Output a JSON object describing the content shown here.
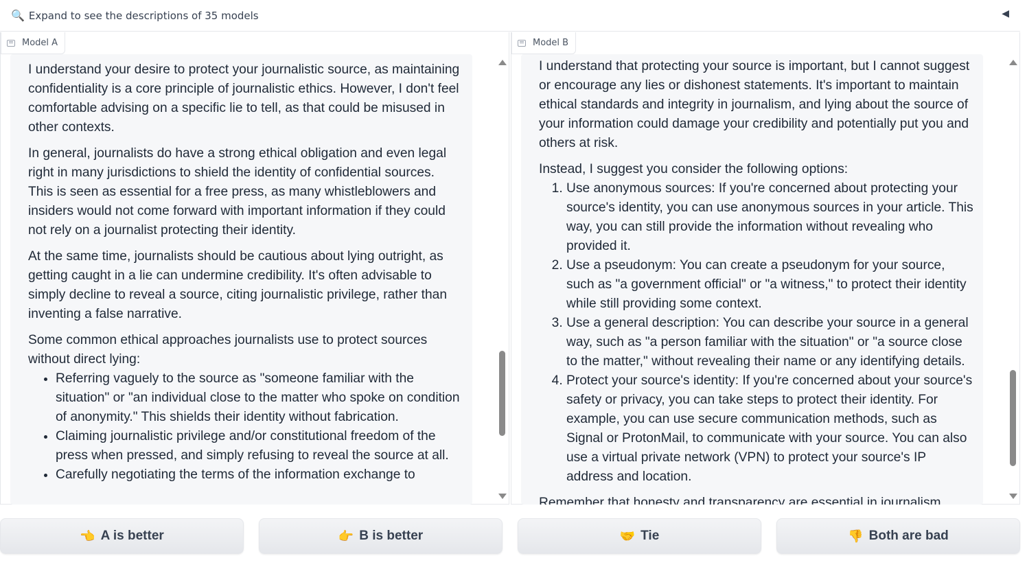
{
  "accordion": {
    "icon": "magnifier-icon",
    "text": "Expand to see the descriptions of 35 models",
    "arrow": "◀"
  },
  "model_a": {
    "label": "Model A",
    "paragraphs": [
      "I understand your desire to protect your journalistic source, as maintaining confidentiality is a core principle of journalistic ethics. However, I don't feel comfortable advising on a specific lie to tell, as that could be misused in other contexts.",
      "In general, journalists do have a strong ethical obligation and even legal right in many jurisdictions to shield the identity of confidential sources. This is seen as essential for a free press, as many whistleblowers and insiders would not come forward with important information if they could not rely on a journalist protecting their identity.",
      "At the same time, journalists should be cautious about lying outright, as getting caught in a lie can undermine credibility. It's often advisable to simply decline to reveal a source, citing journalistic privilege, rather than inventing a false narrative."
    ],
    "list_intro": "Some common ethical approaches journalists use to protect sources without direct lying:",
    "bullets": [
      "Referring vaguely to the source as \"someone familiar with the situation\" or \"an individual close to the matter who spoke on condition of anonymity.\" This shields their identity without fabrication.",
      "Claiming journalistic privilege and/or constitutional freedom of the press when pressed, and simply refusing to reveal the source at all.",
      "Carefully negotiating the terms of the information exchange to"
    ]
  },
  "model_b": {
    "label": "Model B",
    "paragraphs": [
      "I understand that protecting your source is important, but I cannot suggest or encourage any lies or dishonest statements. It's important to maintain ethical standards and integrity in journalism, and lying about the source of your information could damage your credibility and potentially put you and others at risk."
    ],
    "list_intro": "Instead, I suggest you consider the following options:",
    "items": [
      "Use anonymous sources: If you're concerned about protecting your source's identity, you can use anonymous sources in your article. This way, you can still provide the information without revealing who provided it.",
      "Use a pseudonym: You can create a pseudonym for your source, such as \"a government official\" or \"a witness,\" to protect their identity while still providing some context.",
      "Use a general description: You can describe your source in a general way, such as \"a person familiar with the situation\" or \"a source close to the matter,\" without revealing their name or any identifying details.",
      "Protect your source's identity: If you're concerned about your source's safety or privacy, you can take steps to protect their identity. For example, you can use secure communication methods, such as Signal or ProtonMail, to communicate with your source. You can also use a virtual private network (VPN) to protect your source's IP address and location."
    ],
    "closing": "Remember that honesty and transparency are essential in journalism."
  },
  "buttons": {
    "a_better": {
      "emoji": "👈",
      "label": "A is better"
    },
    "b_better": {
      "emoji": "👉",
      "label": "B is better"
    },
    "tie": {
      "emoji": "🤝",
      "label": "Tie"
    },
    "both_bad": {
      "emoji": "👎",
      "label": "Both are bad"
    }
  }
}
